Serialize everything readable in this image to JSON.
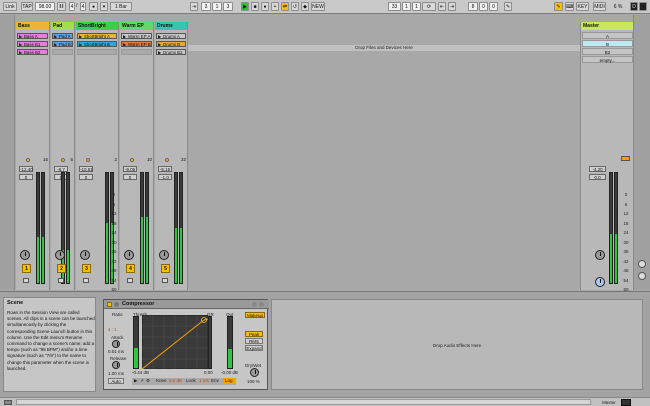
{
  "topbar": {
    "link": "Link",
    "tap": "TAP",
    "tempo": "98.00",
    "time_num": "4",
    "time_den": "4",
    "metro_icon": "metronome",
    "quant": "1 Bar",
    "pos": [
      "3",
      "1",
      "3"
    ],
    "new": "NEW",
    "loop_pos": [
      "33",
      "1",
      "1"
    ],
    "loop_len": [
      "8",
      "0",
      "0"
    ],
    "key": "KEY",
    "midi": "MIDI",
    "cpu": "6 %",
    "d_label": "D"
  },
  "tracks": [
    {
      "name": "Bass",
      "color": "#e7b735",
      "clips": [
        {
          "label": "Bass A",
          "color": "#e87dde"
        },
        {
          "label": "Bass B1",
          "color": "#e87dde"
        },
        {
          "label": "Bass B2",
          "color": "#e87dde"
        }
      ],
      "vol": "-12.40",
      "pan": "0",
      "num": "1",
      "send": "16",
      "level": 0.42
    },
    {
      "name": "Pad",
      "color": "#a4de4a",
      "clips": [
        {
          "label": "Pad A",
          "color": "#5aa0e8"
        },
        {
          "label": "Pad B1",
          "color": "#5aa0e8"
        }
      ],
      "vol": "-8.7",
      "pan": "0",
      "num": "2",
      "send": "6",
      "level": 0.3
    },
    {
      "name": "ShortBright",
      "color": "#3acf52",
      "clips": [
        {
          "label": "ShortBright A",
          "color": "#e7b735"
        },
        {
          "label": "ShortBright B",
          "color": "#2aa8e0"
        }
      ],
      "vol": "-10.61",
      "pan": "0",
      "num": "3",
      "send": "2",
      "level": 0.55
    },
    {
      "name": "Warm EP",
      "color": "#5fd96a",
      "clips": [
        {
          "label": "Warm EP A",
          "color": "#c8c8c8"
        },
        {
          "label": "Warm EP B",
          "color": "#e87835"
        }
      ],
      "vol": "-9.05",
      "pan": "0",
      "num": "4",
      "send": "10",
      "level": 0.6
    },
    {
      "name": "Drums",
      "color": "#33c6b0",
      "clips": [
        {
          "label": "Drums A",
          "color": "#c8c8c8"
        },
        {
          "label": "Drums B",
          "color": "#e8a830"
        },
        {
          "label": "Drums B2",
          "color": "#c8c8c8"
        }
      ],
      "vol": "-5.15",
      "pan": "-1.0",
      "num": "5",
      "send": "32",
      "level": 0.5
    }
  ],
  "drop_files": "Drop Files and Devices Here",
  "db_scale": [
    "0",
    "6",
    "12",
    "18",
    "24",
    "30",
    "36",
    "42",
    "48",
    "54",
    "60"
  ],
  "master": {
    "name": "Master",
    "scenes": [
      "A",
      "B",
      "B2",
      "empty..."
    ],
    "vol": "-4.20",
    "pan": "0.0",
    "level": 0.45,
    "scale": [
      "0",
      "6",
      "12",
      "18",
      "24",
      "30",
      "36",
      "42",
      "48",
      "54",
      "60"
    ]
  },
  "info": {
    "title": "Scene",
    "body": "Rows in the Session View are called scenes. All clips in a scene can be launched simultaneously by clicking the corresponding Scene Launch button in this column. Use the Edit menu's Rename command to change a scene's name; add a tempo (such as \"98 BPM\") and/or a time signature (such as \"7/8\") to the name to change this parameter when the scene is launched."
  },
  "compressor": {
    "title": "Compressor",
    "ratio_label": "Ratio",
    "ratio": "4 : 1",
    "attack_label": "Attack",
    "attack": "0.01 ms",
    "release_label": "Release",
    "release": "1.00 ms",
    "auto": "Auto",
    "thresh_label": "Thresh",
    "gr_label": "GR",
    "out_label": "Out",
    "thresh_val": "-0.44 dB",
    "gr_val": "0.00",
    "out_val": "-0.00 dB",
    "makeup": "Makeup",
    "peak": "Peak",
    "rms": "RMS",
    "expand": "Expand",
    "drywet_label": "Dry/Wet",
    "drywet": "100 %",
    "knee_label": "Knee",
    "knee": "6.0 dB",
    "look_label": "Look",
    "look": "1 ms",
    "env_label": "Env",
    "env": "Log"
  },
  "fx_drop": "Drop Audio Effects Here",
  "status": {
    "master_label": "Master"
  }
}
